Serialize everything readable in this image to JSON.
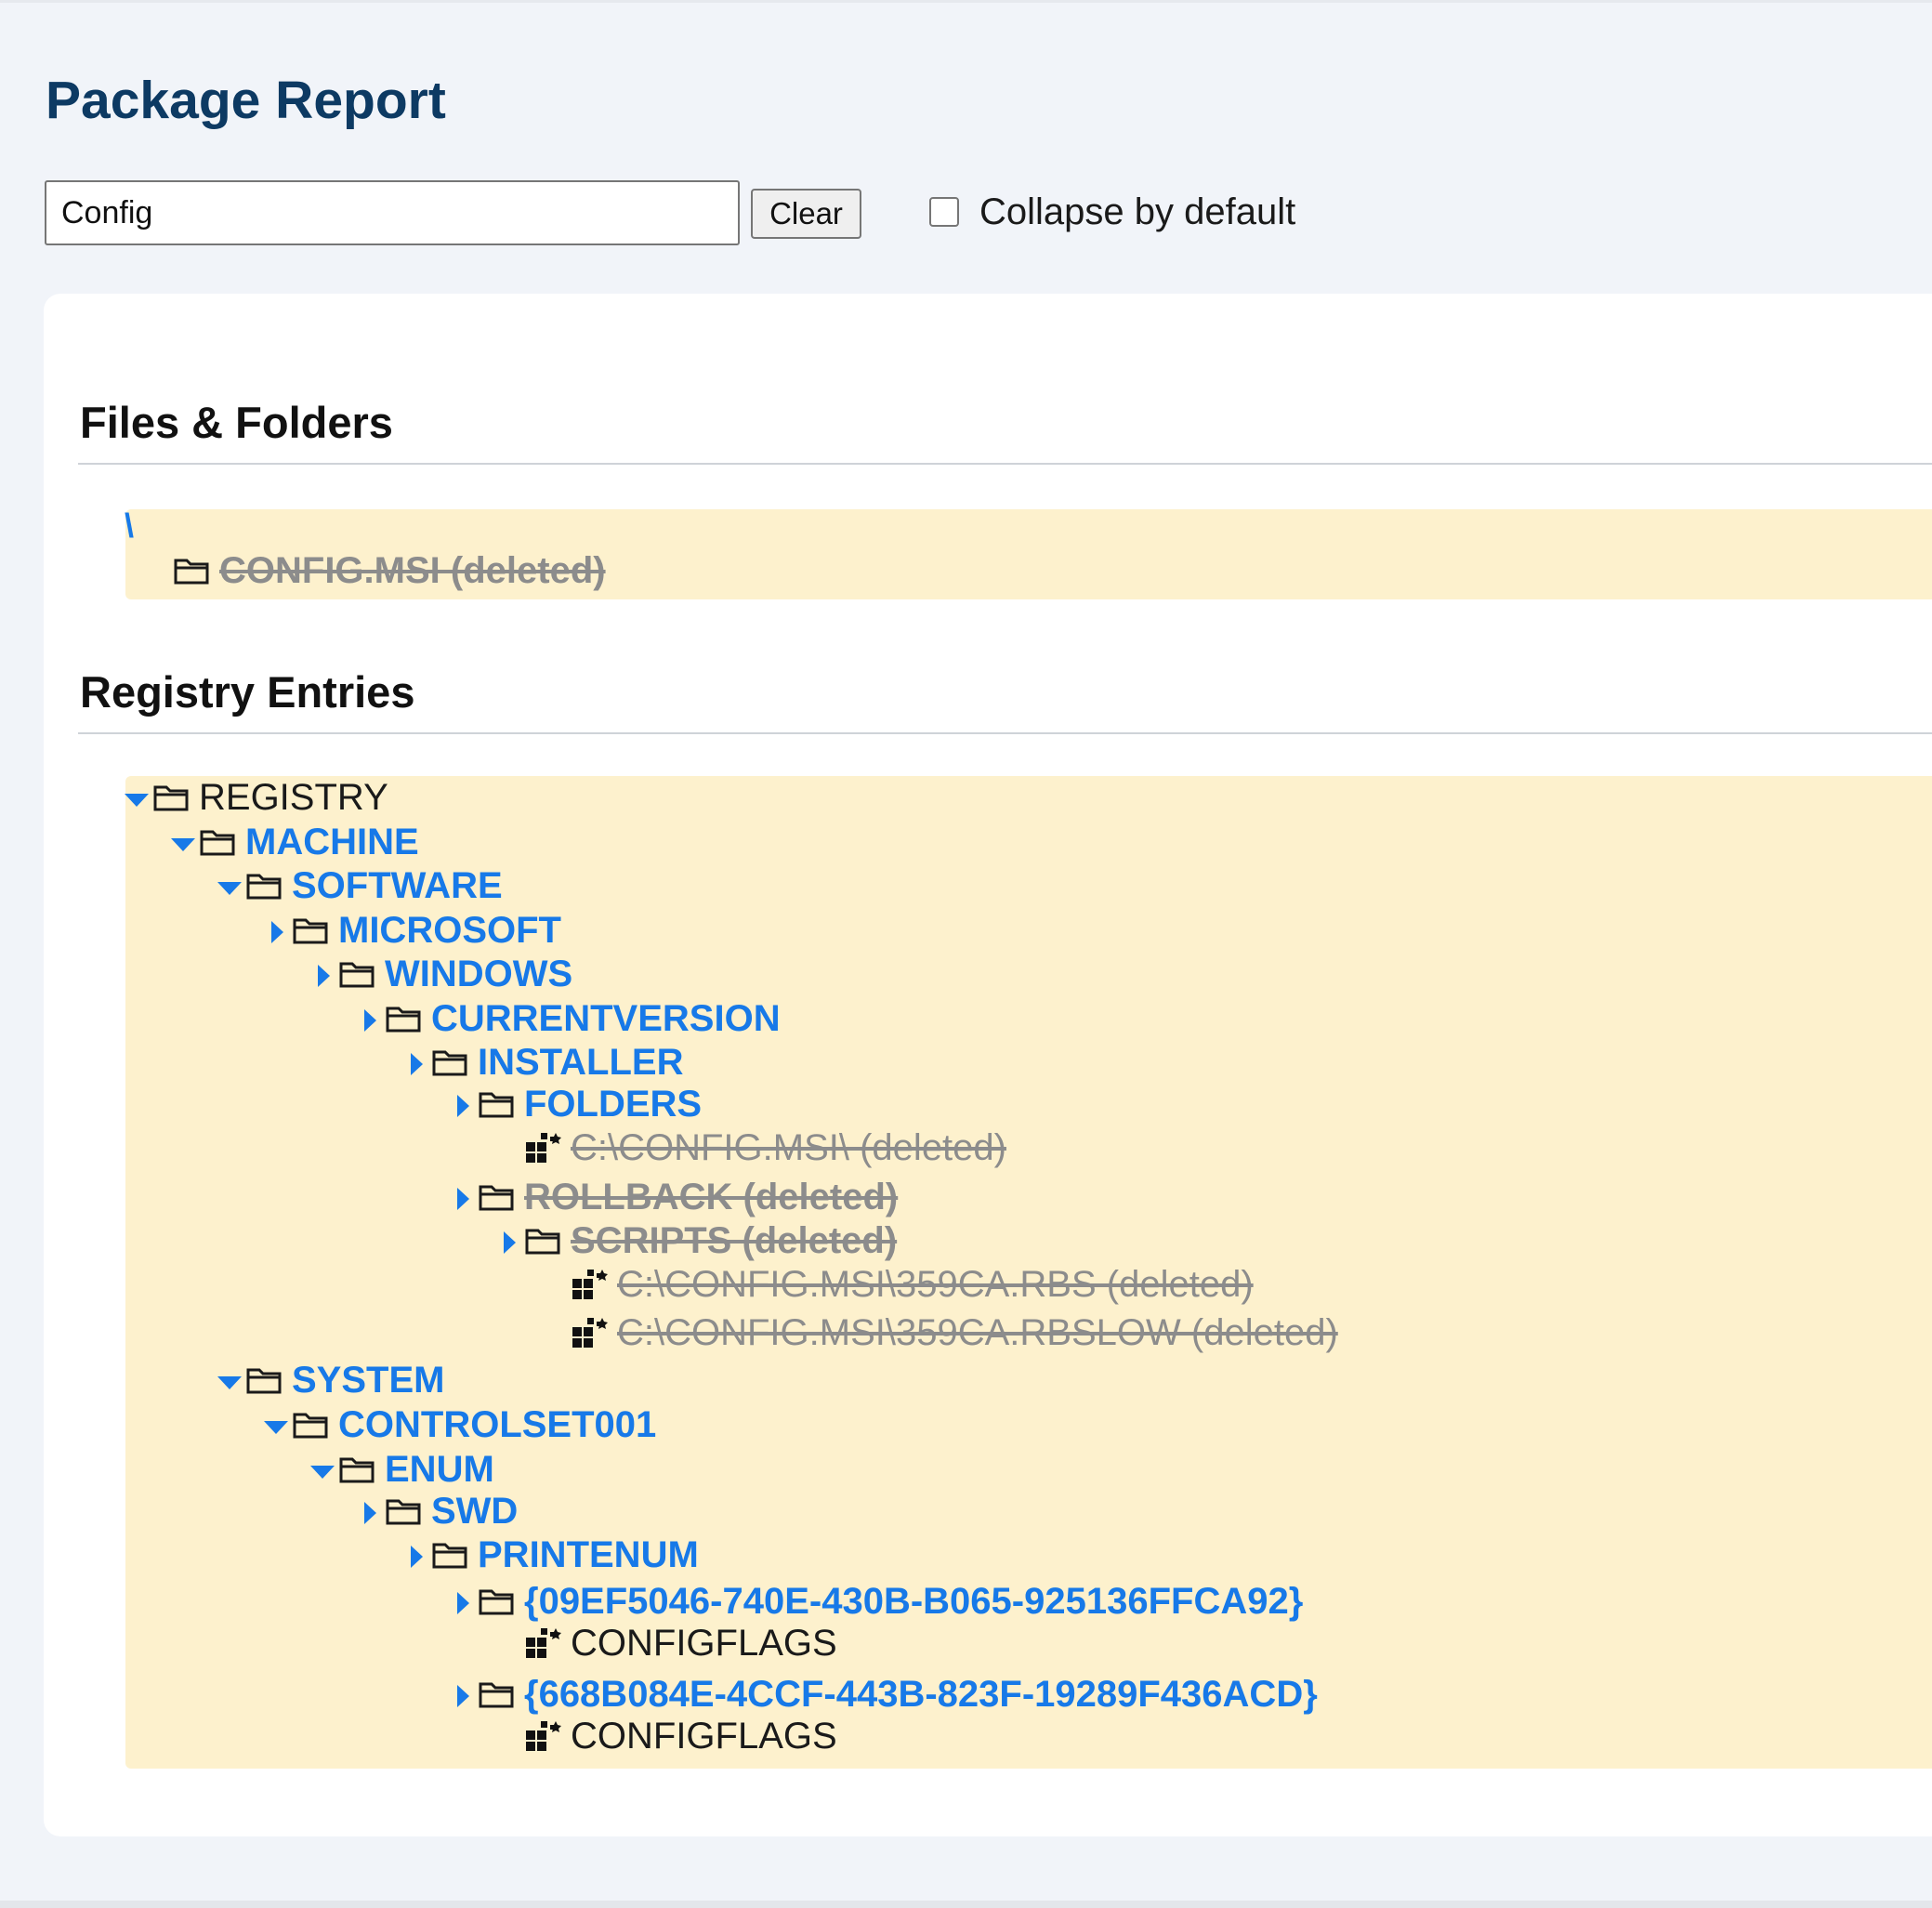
{
  "page": {
    "title": "Package Report"
  },
  "toolbar": {
    "search_value": "Config",
    "clear_label": "Clear",
    "collapse_label": "Collapse by default",
    "collapse_checked": false
  },
  "files": {
    "heading": "Files & Folders",
    "root": "\\",
    "items": [
      {
        "label": "CONFIG.MSI (deleted)",
        "icon": "folder-icon",
        "deleted": true
      }
    ]
  },
  "registry": {
    "heading": "Registry Entries",
    "nodes": [
      {
        "depth": 0,
        "toggle": "expanded",
        "icon": "folder-icon",
        "label": "REGISTRY",
        "style": "plain"
      },
      {
        "depth": 1,
        "toggle": "expanded",
        "icon": "folder-icon",
        "label": "MACHINE",
        "style": "link"
      },
      {
        "depth": 2,
        "toggle": "expanded",
        "icon": "folder-icon",
        "label": "SOFTWARE",
        "style": "link"
      },
      {
        "depth": 3,
        "toggle": "collapsed",
        "icon": "folder-icon",
        "label": "MICROSOFT",
        "style": "link"
      },
      {
        "depth": 4,
        "toggle": "collapsed",
        "icon": "folder-icon",
        "label": "WINDOWS",
        "style": "link"
      },
      {
        "depth": 5,
        "toggle": "collapsed",
        "icon": "folder-icon",
        "label": "CURRENTVERSION",
        "style": "link"
      },
      {
        "depth": 6,
        "toggle": "collapsed",
        "icon": "folder-icon",
        "label": "INSTALLER",
        "style": "link"
      },
      {
        "depth": 7,
        "toggle": "collapsed",
        "icon": "folder-icon",
        "label": "FOLDERS",
        "style": "link"
      },
      {
        "depth": 8,
        "toggle": "none",
        "icon": "registry-value-icon",
        "label": "C:\\CONFIG.MSI\\ (deleted)",
        "style": "deleted"
      },
      {
        "depth": 7,
        "toggle": "collapsed",
        "icon": "folder-icon",
        "label": "ROLLBACK (deleted)",
        "style": "deleted-bold"
      },
      {
        "depth": 8,
        "toggle": "collapsed",
        "icon": "folder-icon",
        "label": "SCRIPTS (deleted)",
        "style": "deleted-bold"
      },
      {
        "depth": 9,
        "toggle": "none",
        "icon": "registry-value-icon",
        "label": "C:\\CONFIG.MSI\\359CA.RBS (deleted)",
        "style": "deleted"
      },
      {
        "depth": 9,
        "toggle": "none",
        "icon": "registry-value-icon",
        "label": "C:\\CONFIG.MSI\\359CA.RBSLOW (deleted)",
        "style": "deleted"
      },
      {
        "depth": 2,
        "toggle": "expanded",
        "icon": "folder-icon",
        "label": "SYSTEM",
        "style": "link"
      },
      {
        "depth": 3,
        "toggle": "expanded",
        "icon": "folder-icon",
        "label": "CONTROLSET001",
        "style": "link"
      },
      {
        "depth": 4,
        "toggle": "expanded",
        "icon": "folder-icon",
        "label": "ENUM",
        "style": "link"
      },
      {
        "depth": 5,
        "toggle": "collapsed",
        "icon": "folder-icon",
        "label": "SWD",
        "style": "link"
      },
      {
        "depth": 6,
        "toggle": "collapsed",
        "icon": "folder-icon",
        "label": "PRINTENUM",
        "style": "link"
      },
      {
        "depth": 7,
        "toggle": "collapsed",
        "icon": "folder-icon",
        "label": "{09EF5046-740E-430B-B065-925136FFCA92}",
        "style": "link"
      },
      {
        "depth": 8,
        "toggle": "none",
        "icon": "registry-value-icon",
        "label": "CONFIGFLAGS",
        "style": "plain"
      },
      {
        "depth": 7,
        "toggle": "collapsed",
        "icon": "folder-icon",
        "label": "{668B084E-4CCF-443B-823F-19289F436ACD}",
        "style": "link"
      },
      {
        "depth": 8,
        "toggle": "none",
        "icon": "registry-value-icon",
        "label": "CONFIGFLAGS",
        "style": "plain"
      }
    ]
  }
}
